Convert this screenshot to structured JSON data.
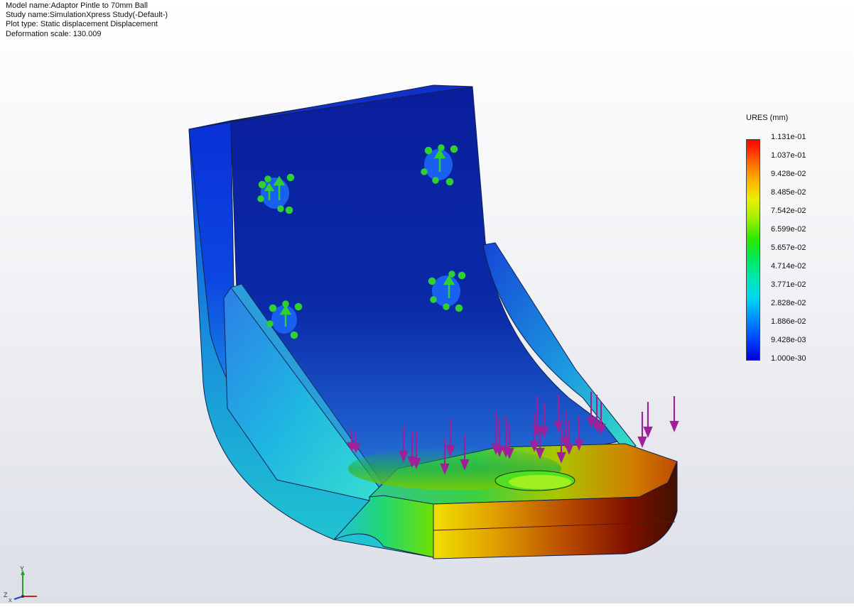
{
  "info": {
    "model_name": "Model name:Adaptor Pintle to 70mm Ball",
    "study_name": "Study name:SimulationXpress Study(-Default-)",
    "plot_type": "Plot type: Static displacement Displacement",
    "deformation_scale": "Deformation scale: 130.009"
  },
  "legend": {
    "title": "URES (mm)",
    "ticks": [
      "1.131e-01",
      "1.037e-01",
      "9.428e-02",
      "8.485e-02",
      "7.542e-02",
      "6.599e-02",
      "5.657e-02",
      "4.714e-02",
      "3.771e-02",
      "2.828e-02",
      "1.886e-02",
      "9.428e-03",
      "1.000e-30"
    ]
  },
  "triad": {
    "y_label": "Y",
    "z_label": "Z",
    "x_label": "X"
  },
  "colors": {
    "min": "#0000e0",
    "max": "#ff0000",
    "fixture_arrows": "#2ecc30",
    "load_arrows": "#a0209a"
  },
  "icons": [
    "fixed-geometry-arrow-icon",
    "force-arrow-icon",
    "coordinate-triad-icon"
  ]
}
